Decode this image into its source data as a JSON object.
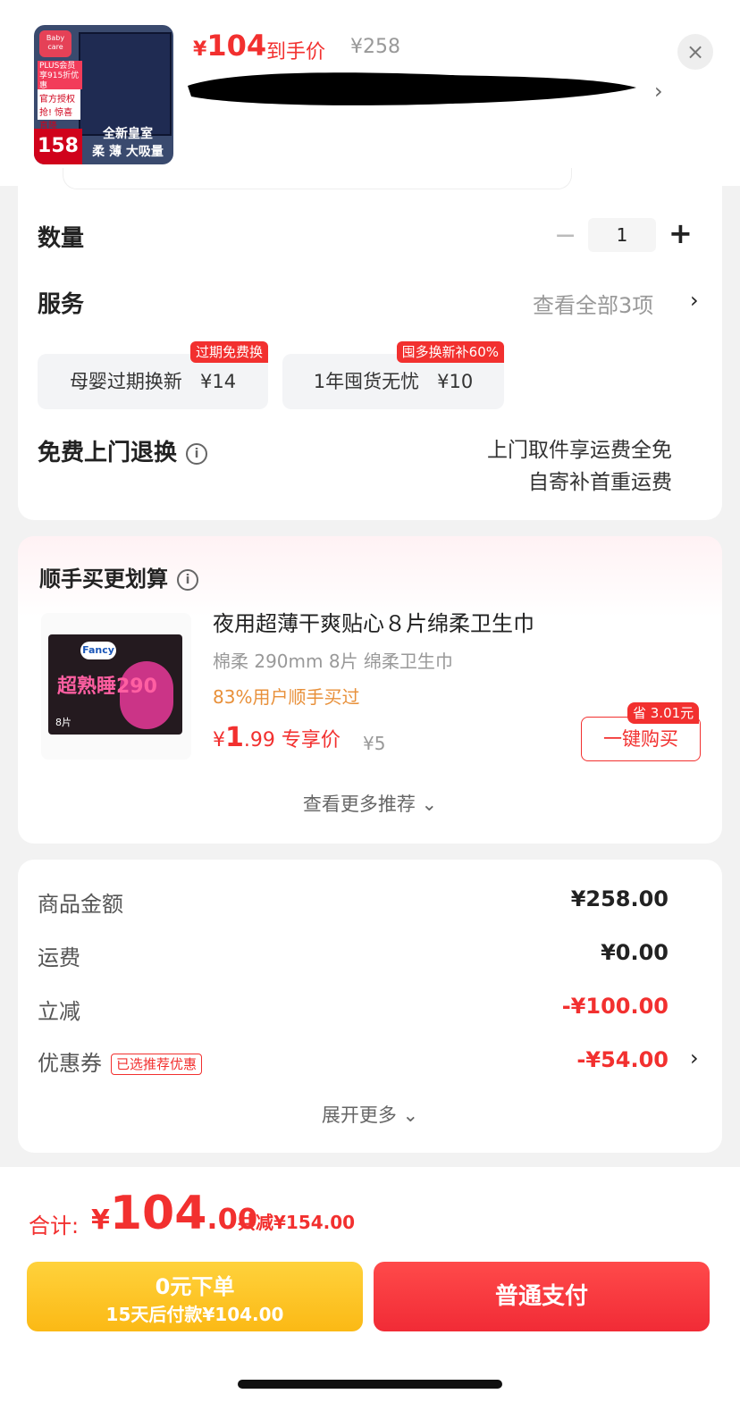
{
  "header": {
    "thumb": {
      "brand": "Baby care",
      "plus_badge": "PLUS会员享915折优惠",
      "auth_badge": "官方授权",
      "promo_badge": "抢! 惊喜直降",
      "price": "158",
      "caption_line1": "全新皇室",
      "caption_line2": "柔 薄 大吸量"
    },
    "yen": "¥",
    "price": "104",
    "price_label": "到手价",
    "original_price": "¥258"
  },
  "quantity": {
    "label": "数量",
    "minus": "−",
    "value": "1",
    "plus": "+"
  },
  "services": {
    "label": "服务",
    "view_all": "查看全部3项",
    "items": [
      {
        "name": "母婴过期换新",
        "price": "¥14",
        "tag": "过期免费换"
      },
      {
        "name": "1年囤货无忧",
        "price": "¥10",
        "tag": "囤多换新补60%"
      }
    ]
  },
  "return": {
    "label": "免费上门退换",
    "info_line1": "上门取件享运费全免",
    "info_line2": "自寄补首重运费"
  },
  "addon": {
    "title": "顺手买更划算",
    "product": {
      "brand": "Fancy",
      "pack_text": "超熟睡290",
      "pack_count": "8片",
      "name": "夜用超薄干爽贴心８片绵柔卫生巾",
      "spec": "棉柔 290mm 8片 绵柔卫生巾",
      "bought": "83%用户顺手买过",
      "price_yen": "¥",
      "price_int": "1",
      "price_dec": ".99",
      "price_label": "专享价",
      "original_price": "¥5",
      "save_tag": "省 3.01元",
      "buy_label": "一键购买"
    },
    "more": "查看更多推荐 ⌄"
  },
  "summary": {
    "rows": [
      {
        "label": "商品金额",
        "value": "¥258.00"
      },
      {
        "label": "运费",
        "value": "¥0.00"
      },
      {
        "label": "立减",
        "value": "-¥100.00"
      },
      {
        "label": "优惠券",
        "value": "-¥54.00",
        "tag": "已选推荐优惠"
      }
    ],
    "expand": "展开更多 ⌄"
  },
  "footer": {
    "total_label": "合计:",
    "total_yen": "¥",
    "total_int": "104",
    "total_dec": ".00",
    "saved": "共减¥154.00",
    "later_line1": "0元下单",
    "later_line2": "15天后付款¥104.00",
    "pay_label": "普通支付"
  },
  "colors": {
    "accent": "#f2302f",
    "later_button": "#fbb915",
    "pay_button": "#f12b36"
  }
}
